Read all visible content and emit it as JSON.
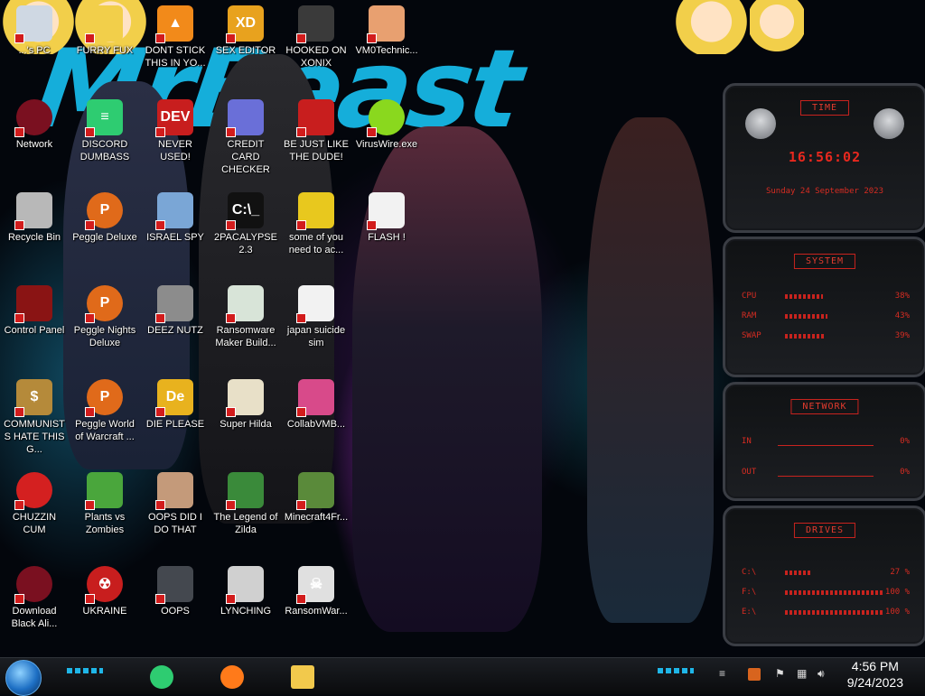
{
  "desktop": {
    "wallpaper_text": "MrBeast",
    "icons": [
      {
        "label": "...'s PC",
        "icon": "computer-icon",
        "color": "#cfd8e3",
        "glyph": "",
        "col": 0,
        "row": 0
      },
      {
        "label": "Network",
        "icon": "alien-orb-icon",
        "color": "#7a1020",
        "glyph": "",
        "col": 0,
        "row": 1
      },
      {
        "label": "Recycle Bin",
        "icon": "recycle-bin-icon",
        "color": "#b8b8b8",
        "glyph": "",
        "col": 0,
        "row": 2
      },
      {
        "label": "Control Panel",
        "icon": "control-panel-icon",
        "color": "#8a1414",
        "glyph": "",
        "col": 0,
        "row": 3
      },
      {
        "label": "COMMUNISTS HATE THIS G...",
        "icon": "money-bag-icon",
        "color": "#b58a3a",
        "glyph": "$",
        "col": 0,
        "row": 4
      },
      {
        "label": "CHUZZIN CUM",
        "icon": "chuzzle-icon",
        "color": "#d42020",
        "glyph": "",
        "col": 0,
        "row": 5
      },
      {
        "label": "Download Black Ali...",
        "icon": "alien-orb-icon",
        "color": "#7a1020",
        "glyph": "",
        "col": 0,
        "row": 6
      },
      {
        "label": "FURRY FUX",
        "icon": "anime-face-icon",
        "color": "#f2cf4a",
        "glyph": "",
        "col": 1,
        "row": 0
      },
      {
        "label": "DISCORD DUMBASS",
        "icon": "discord-icon",
        "color": "#2ecc71",
        "glyph": "≡",
        "col": 1,
        "row": 1
      },
      {
        "label": "Peggle Deluxe",
        "icon": "peggle-icon",
        "color": "#e06a1a",
        "glyph": "P",
        "col": 1,
        "row": 2
      },
      {
        "label": "Peggle Nights Deluxe",
        "icon": "peggle-icon",
        "color": "#e06a1a",
        "glyph": "P",
        "col": 1,
        "row": 3
      },
      {
        "label": "Peggle World of Warcraft ...",
        "icon": "peggle-icon",
        "color": "#e06a1a",
        "glyph": "P",
        "col": 1,
        "row": 4
      },
      {
        "label": "Plants vs Zombies",
        "icon": "flower-icon",
        "color": "#4aa63c",
        "glyph": "",
        "col": 1,
        "row": 5
      },
      {
        "label": "UKRAINE",
        "icon": "radiation-icon",
        "color": "#c81e1e",
        "glyph": "☢",
        "col": 1,
        "row": 6
      },
      {
        "label": "DONT STICK THIS IN YO...",
        "icon": "vlc-cone-icon",
        "color": "#f28a1a",
        "glyph": "▲",
        "col": 2,
        "row": 0
      },
      {
        "label": "NEVER USED!",
        "icon": "devcpp-icon",
        "color": "#c81e1e",
        "glyph": "DEV",
        "col": 2,
        "row": 1
      },
      {
        "label": "ISRAEL SPY",
        "icon": "spy-window-icon",
        "color": "#7aa6d6",
        "glyph": "",
        "col": 2,
        "row": 2
      },
      {
        "label": "DEEZ NUTZ",
        "icon": "windows-stack-icon",
        "color": "#8c8c8c",
        "glyph": "",
        "col": 2,
        "row": 3
      },
      {
        "label": "DIE PLEASE",
        "icon": "die-icon",
        "color": "#e8b21e",
        "glyph": "De",
        "col": 2,
        "row": 4
      },
      {
        "label": "OOPS DID I DO THAT",
        "icon": "portrait-icon",
        "color": "#c49a7a",
        "glyph": "",
        "col": 2,
        "row": 5
      },
      {
        "label": "OOPS",
        "icon": "monitor-icon",
        "color": "#44484f",
        "glyph": "",
        "col": 2,
        "row": 6
      },
      {
        "label": "SEX EDITOR",
        "icon": "hex-editor-icon",
        "color": "#e8a21e",
        "glyph": "XD",
        "col": 3,
        "row": 0
      },
      {
        "label": "CREDIT CARD CHECKER",
        "icon": "credit-card-icon",
        "color": "#6a6fd8",
        "glyph": "",
        "col": 3,
        "row": 1
      },
      {
        "label": "2PACALYPSE 2.3",
        "icon": "terminal-icon",
        "color": "#111111",
        "glyph": "C:\\_",
        "col": 3,
        "row": 2
      },
      {
        "label": "Ransomware Maker Build...",
        "icon": "window-app-icon",
        "color": "#d8e4d8",
        "glyph": "",
        "col": 3,
        "row": 3
      },
      {
        "label": "Super Hilda",
        "icon": "pixel-art-icon",
        "color": "#e8e0c8",
        "glyph": "",
        "col": 3,
        "row": 4
      },
      {
        "label": "The Legend of Zilda",
        "icon": "pixel-hero-icon",
        "color": "#3a8a3a",
        "glyph": "",
        "col": 3,
        "row": 5
      },
      {
        "label": "LYNCHING",
        "icon": "noose-icon",
        "color": "#d0d0d0",
        "glyph": "",
        "col": 3,
        "row": 6
      },
      {
        "label": "HOOKED ON XONIX",
        "icon": "xonix-icon",
        "color": "#3a3a3a",
        "glyph": "",
        "col": 4,
        "row": 0
      },
      {
        "label": "BE JUST LIKE THE DUDE!",
        "icon": "santa-icon",
        "color": "#c81e1e",
        "glyph": "",
        "col": 4,
        "row": 1
      },
      {
        "label": "some of you need to ac...",
        "icon": "beaver-icon",
        "color": "#e8c81e",
        "glyph": "",
        "col": 4,
        "row": 2
      },
      {
        "label": "japan suicide sim",
        "icon": "document-icon",
        "color": "#f2f2f2",
        "glyph": "",
        "col": 4,
        "row": 3
      },
      {
        "label": "CollabVMB...",
        "icon": "pink-monitor-icon",
        "color": "#d84a8a",
        "glyph": "",
        "col": 4,
        "row": 4
      },
      {
        "label": "Minecraft4Fr...",
        "icon": "grass-block-icon",
        "color": "#5a8a3a",
        "glyph": "",
        "col": 4,
        "row": 5
      },
      {
        "label": "RansomWar...",
        "icon": "skull-icon",
        "color": "#e0e0e0",
        "glyph": "☠",
        "col": 4,
        "row": 6
      },
      {
        "label": "VM0Technic...",
        "icon": "doctor-icon",
        "color": "#e8a070",
        "glyph": "",
        "col": 5,
        "row": 0
      },
      {
        "label": "VirusWire.exe",
        "icon": "lime-icon",
        "color": "#8ad81e",
        "glyph": "",
        "col": 5,
        "row": 1
      },
      {
        "label": "FLASH !",
        "icon": "flash-document-icon",
        "color": "#f2f2f2",
        "glyph": "",
        "col": 5,
        "row": 2
      }
    ]
  },
  "widget": {
    "time": {
      "header": "TIME",
      "clock": "16:56:02",
      "date": "Sunday 24 September 2023"
    },
    "system": {
      "header": "SYSTEM",
      "rows": [
        {
          "key": "CPU",
          "value": "38%",
          "level": 0.38
        },
        {
          "key": "RAM",
          "value": "43%",
          "level": 0.43
        },
        {
          "key": "SWAP",
          "value": "39%",
          "level": 0.39
        }
      ]
    },
    "network": {
      "header": "NETWORK",
      "rows": [
        {
          "key": "IN",
          "value": "0%"
        },
        {
          "key": "OUT",
          "value": "0%"
        }
      ]
    },
    "drives": {
      "header": "DRIVES",
      "rows": [
        {
          "key": "C:\\",
          "value": "27 %",
          "level": 0.27
        },
        {
          "key": "F:\\",
          "value": "100 %",
          "level": 1.0
        },
        {
          "key": "E:\\",
          "value": "100 %",
          "level": 1.0
        }
      ]
    }
  },
  "taskbar": {
    "apps": [
      {
        "name": "discord-icon",
        "color": "#2ecc71"
      },
      {
        "name": "firefox-icon",
        "color": "#ff7a1a"
      },
      {
        "name": "file-explorer-icon",
        "color": "#f2c94c"
      }
    ],
    "clock": {
      "time": "4:56 PM",
      "date": "9/24/2023"
    }
  }
}
